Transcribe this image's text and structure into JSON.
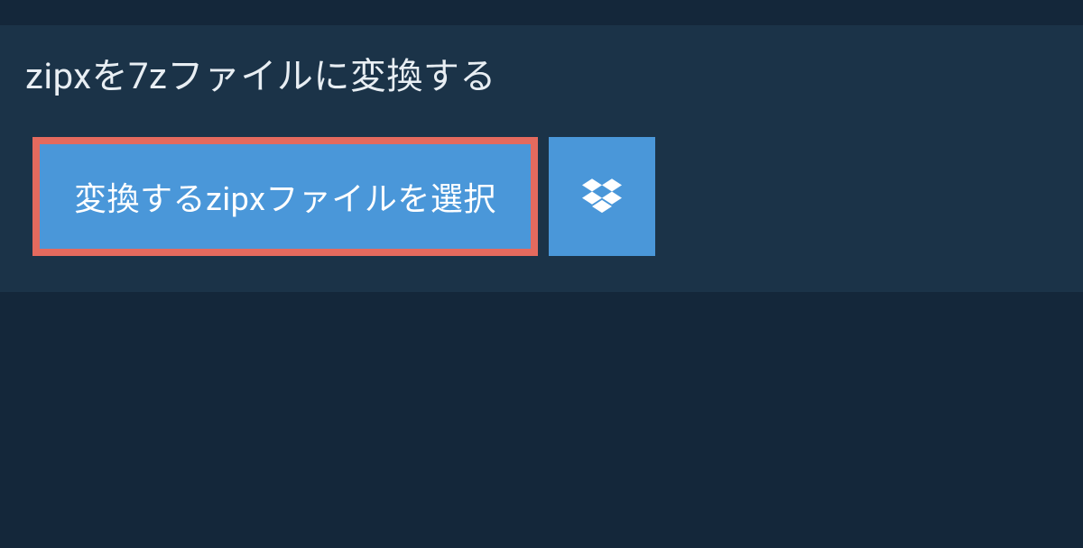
{
  "header": {
    "title": "zipxを7zファイルに変換する"
  },
  "actions": {
    "select_file_label": "変換するzipxファイルを選択"
  }
}
